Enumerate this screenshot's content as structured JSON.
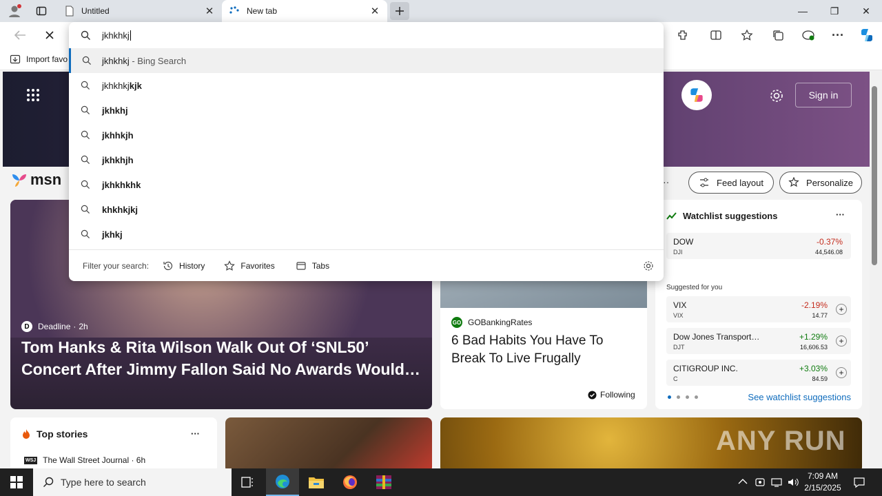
{
  "browser": {
    "tabs": [
      {
        "title": "Untitled"
      },
      {
        "title": "New tab"
      }
    ],
    "address": {
      "value": "jkhkhkj"
    },
    "favbar": {
      "import_label": "Import favo"
    }
  },
  "dropdown": {
    "suggestions": [
      {
        "text": "jkhkhkj",
        "suffix": " - Bing Search",
        "bold": ""
      },
      {
        "text": "jkhkhkj",
        "suffix": "",
        "bold": "kjk"
      },
      {
        "text": "",
        "suffix": "",
        "bold": "jkhkhj"
      },
      {
        "text": "",
        "suffix": "",
        "bold": "jkhhkjh"
      },
      {
        "text": "",
        "suffix": "",
        "bold": "jkhkhjh"
      },
      {
        "text": "",
        "suffix": "",
        "bold": "jkhkhkhk"
      },
      {
        "text": "",
        "suffix": "",
        "bold": "khkhkjkj"
      },
      {
        "text": "",
        "suffix": "",
        "bold": "jkhkj"
      }
    ],
    "filter_label": "Filter your search:",
    "filters": [
      "History",
      "Favorites",
      "Tabs"
    ]
  },
  "msn": {
    "logo": "msn",
    "sign_in": "Sign in",
    "feed_layout": "Feed layout",
    "personalize": "Personalize",
    "hero_story": {
      "source": "Deadline",
      "age": "2h",
      "headline": "Tom Hanks & Rita Wilson Walk Out Of ‘SNL50’ Concert After Jimmy Fallon Said No Awards Would…"
    },
    "mid_story": {
      "source": "GOBankingRates",
      "headline": "6 Bad Habits You Have To Break To Live Frugally",
      "following": "Following"
    },
    "watchlist": {
      "title": "Watchlist suggestions",
      "main": {
        "name": "DOW",
        "sym": "DJI",
        "change": "-0.37%",
        "price": "44,546.08"
      },
      "suggested_label": "Suggested for you",
      "items": [
        {
          "name": "VIX",
          "sym": "VIX",
          "change": "-2.19%",
          "price": "14.77"
        },
        {
          "name": "Dow Jones Transport…",
          "sym": "DJT",
          "change": "+1.29%",
          "price": "16,606.53"
        },
        {
          "name": "CITIGROUP INC.",
          "sym": "C",
          "change": "+3.03%",
          "price": "84.59"
        }
      ],
      "see_link": "See watchlist suggestions"
    },
    "top_stories": {
      "title": "Top stories",
      "first_source": "The Wall Street Journal · 6h",
      "wsj": "WSJ"
    },
    "watermark": "ANY RUN"
  },
  "taskbar": {
    "search_placeholder": "Type here to search",
    "time": "7:09 AM",
    "date": "2/15/2025"
  },
  "colors": {
    "negative": "#c42b1c",
    "positive": "#0f7b0f",
    "link": "#0f6cbd",
    "accent": "#0f6cbd"
  }
}
